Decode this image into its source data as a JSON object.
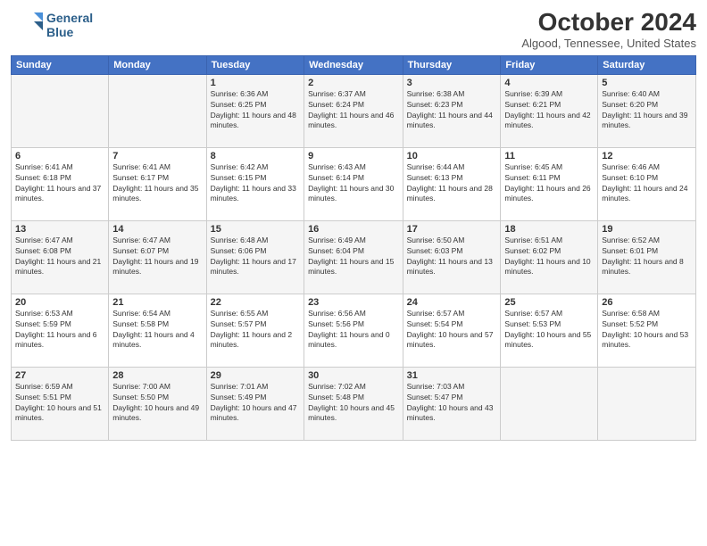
{
  "header": {
    "logo_line1": "General",
    "logo_line2": "Blue",
    "month": "October 2024",
    "location": "Algood, Tennessee, United States"
  },
  "days_of_week": [
    "Sunday",
    "Monday",
    "Tuesday",
    "Wednesday",
    "Thursday",
    "Friday",
    "Saturday"
  ],
  "weeks": [
    [
      {
        "day": "",
        "sunrise": "",
        "sunset": "",
        "daylight": ""
      },
      {
        "day": "",
        "sunrise": "",
        "sunset": "",
        "daylight": ""
      },
      {
        "day": "1",
        "sunrise": "Sunrise: 6:36 AM",
        "sunset": "Sunset: 6:25 PM",
        "daylight": "Daylight: 11 hours and 48 minutes."
      },
      {
        "day": "2",
        "sunrise": "Sunrise: 6:37 AM",
        "sunset": "Sunset: 6:24 PM",
        "daylight": "Daylight: 11 hours and 46 minutes."
      },
      {
        "day": "3",
        "sunrise": "Sunrise: 6:38 AM",
        "sunset": "Sunset: 6:23 PM",
        "daylight": "Daylight: 11 hours and 44 minutes."
      },
      {
        "day": "4",
        "sunrise": "Sunrise: 6:39 AM",
        "sunset": "Sunset: 6:21 PM",
        "daylight": "Daylight: 11 hours and 42 minutes."
      },
      {
        "day": "5",
        "sunrise": "Sunrise: 6:40 AM",
        "sunset": "Sunset: 6:20 PM",
        "daylight": "Daylight: 11 hours and 39 minutes."
      }
    ],
    [
      {
        "day": "6",
        "sunrise": "Sunrise: 6:41 AM",
        "sunset": "Sunset: 6:18 PM",
        "daylight": "Daylight: 11 hours and 37 minutes."
      },
      {
        "day": "7",
        "sunrise": "Sunrise: 6:41 AM",
        "sunset": "Sunset: 6:17 PM",
        "daylight": "Daylight: 11 hours and 35 minutes."
      },
      {
        "day": "8",
        "sunrise": "Sunrise: 6:42 AM",
        "sunset": "Sunset: 6:15 PM",
        "daylight": "Daylight: 11 hours and 33 minutes."
      },
      {
        "day": "9",
        "sunrise": "Sunrise: 6:43 AM",
        "sunset": "Sunset: 6:14 PM",
        "daylight": "Daylight: 11 hours and 30 minutes."
      },
      {
        "day": "10",
        "sunrise": "Sunrise: 6:44 AM",
        "sunset": "Sunset: 6:13 PM",
        "daylight": "Daylight: 11 hours and 28 minutes."
      },
      {
        "day": "11",
        "sunrise": "Sunrise: 6:45 AM",
        "sunset": "Sunset: 6:11 PM",
        "daylight": "Daylight: 11 hours and 26 minutes."
      },
      {
        "day": "12",
        "sunrise": "Sunrise: 6:46 AM",
        "sunset": "Sunset: 6:10 PM",
        "daylight": "Daylight: 11 hours and 24 minutes."
      }
    ],
    [
      {
        "day": "13",
        "sunrise": "Sunrise: 6:47 AM",
        "sunset": "Sunset: 6:08 PM",
        "daylight": "Daylight: 11 hours and 21 minutes."
      },
      {
        "day": "14",
        "sunrise": "Sunrise: 6:47 AM",
        "sunset": "Sunset: 6:07 PM",
        "daylight": "Daylight: 11 hours and 19 minutes."
      },
      {
        "day": "15",
        "sunrise": "Sunrise: 6:48 AM",
        "sunset": "Sunset: 6:06 PM",
        "daylight": "Daylight: 11 hours and 17 minutes."
      },
      {
        "day": "16",
        "sunrise": "Sunrise: 6:49 AM",
        "sunset": "Sunset: 6:04 PM",
        "daylight": "Daylight: 11 hours and 15 minutes."
      },
      {
        "day": "17",
        "sunrise": "Sunrise: 6:50 AM",
        "sunset": "Sunset: 6:03 PM",
        "daylight": "Daylight: 11 hours and 13 minutes."
      },
      {
        "day": "18",
        "sunrise": "Sunrise: 6:51 AM",
        "sunset": "Sunset: 6:02 PM",
        "daylight": "Daylight: 11 hours and 10 minutes."
      },
      {
        "day": "19",
        "sunrise": "Sunrise: 6:52 AM",
        "sunset": "Sunset: 6:01 PM",
        "daylight": "Daylight: 11 hours and 8 minutes."
      }
    ],
    [
      {
        "day": "20",
        "sunrise": "Sunrise: 6:53 AM",
        "sunset": "Sunset: 5:59 PM",
        "daylight": "Daylight: 11 hours and 6 minutes."
      },
      {
        "day": "21",
        "sunrise": "Sunrise: 6:54 AM",
        "sunset": "Sunset: 5:58 PM",
        "daylight": "Daylight: 11 hours and 4 minutes."
      },
      {
        "day": "22",
        "sunrise": "Sunrise: 6:55 AM",
        "sunset": "Sunset: 5:57 PM",
        "daylight": "Daylight: 11 hours and 2 minutes."
      },
      {
        "day": "23",
        "sunrise": "Sunrise: 6:56 AM",
        "sunset": "Sunset: 5:56 PM",
        "daylight": "Daylight: 11 hours and 0 minutes."
      },
      {
        "day": "24",
        "sunrise": "Sunrise: 6:57 AM",
        "sunset": "Sunset: 5:54 PM",
        "daylight": "Daylight: 10 hours and 57 minutes."
      },
      {
        "day": "25",
        "sunrise": "Sunrise: 6:57 AM",
        "sunset": "Sunset: 5:53 PM",
        "daylight": "Daylight: 10 hours and 55 minutes."
      },
      {
        "day": "26",
        "sunrise": "Sunrise: 6:58 AM",
        "sunset": "Sunset: 5:52 PM",
        "daylight": "Daylight: 10 hours and 53 minutes."
      }
    ],
    [
      {
        "day": "27",
        "sunrise": "Sunrise: 6:59 AM",
        "sunset": "Sunset: 5:51 PM",
        "daylight": "Daylight: 10 hours and 51 minutes."
      },
      {
        "day": "28",
        "sunrise": "Sunrise: 7:00 AM",
        "sunset": "Sunset: 5:50 PM",
        "daylight": "Daylight: 10 hours and 49 minutes."
      },
      {
        "day": "29",
        "sunrise": "Sunrise: 7:01 AM",
        "sunset": "Sunset: 5:49 PM",
        "daylight": "Daylight: 10 hours and 47 minutes."
      },
      {
        "day": "30",
        "sunrise": "Sunrise: 7:02 AM",
        "sunset": "Sunset: 5:48 PM",
        "daylight": "Daylight: 10 hours and 45 minutes."
      },
      {
        "day": "31",
        "sunrise": "Sunrise: 7:03 AM",
        "sunset": "Sunset: 5:47 PM",
        "daylight": "Daylight: 10 hours and 43 minutes."
      },
      {
        "day": "",
        "sunrise": "",
        "sunset": "",
        "daylight": ""
      },
      {
        "day": "",
        "sunrise": "",
        "sunset": "",
        "daylight": ""
      }
    ]
  ]
}
